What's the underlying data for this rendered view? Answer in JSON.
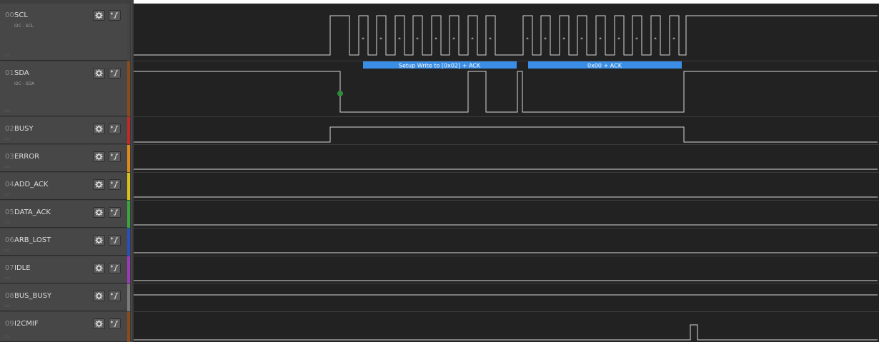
{
  "channels": [
    {
      "num": "00",
      "name": "SCL",
      "sub": "I2C - SCL",
      "color": "#444444"
    },
    {
      "num": "01",
      "name": "SDA",
      "sub": "I2C - SDA",
      "color": "#8a4a1e"
    },
    {
      "num": "02",
      "name": "BUSY",
      "sub": "",
      "color": "#c0282a"
    },
    {
      "num": "03",
      "name": "ERROR",
      "sub": "",
      "color": "#e08a1a"
    },
    {
      "num": "04",
      "name": "ADD_ACK",
      "sub": "",
      "color": "#d6c21a"
    },
    {
      "num": "05",
      "name": "DATA_ACK",
      "sub": "",
      "color": "#3aa53a"
    },
    {
      "num": "06",
      "name": "ARB_LOST",
      "sub": "",
      "color": "#2a4fb8"
    },
    {
      "num": "07",
      "name": "IDLE",
      "sub": "",
      "color": "#9a3ab8"
    },
    {
      "num": "08",
      "name": "BUS_BUSY",
      "sub": "",
      "color": "#7a7a7a"
    },
    {
      "num": "09",
      "name": "I2CMIF",
      "sub": "",
      "color": "#8a4a1e"
    }
  ],
  "buttons": {
    "gear_icon": "gear-icon",
    "trigger_icon": "trigger-icon"
  },
  "decoder": {
    "label1": "Setup Write to [0x02] + ACK",
    "label2": "0x00 + ACK",
    "color": "#3a8ee6"
  },
  "colors": {
    "wave": "#d8d8d8",
    "panel": "#474747",
    "background": "#222222"
  }
}
